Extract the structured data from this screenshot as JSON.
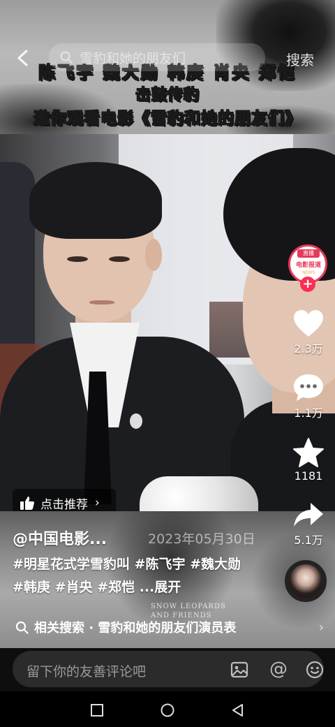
{
  "search": {
    "query": "雪豹和她的朋友们",
    "button": "搜索"
  },
  "banner": {
    "line1": "陈飞宇  魏大勋  韩庚  肖央  郑恺",
    "line2": "击鼓传豹",
    "line3": "邀你观看电影《雪豹和她的朋友们》"
  },
  "recommend": {
    "label": "点击推荐",
    "arrow": "›"
  },
  "post": {
    "author": "@中国电影...",
    "date": "2023年05月30日",
    "hashtags": "#明星花式学雪豹叫 #陈飞宇 #魏大勋 #韩庚 #肖央 #郑恺",
    "expand": "...展开",
    "logo_en_line1": "SNOW LEOPARDS",
    "logo_en_line2": "AND FRIENDS"
  },
  "related": {
    "text": "相关搜索 · 雪豹和她的朋友们演员表",
    "chevron": "›"
  },
  "creator": {
    "tag": "直播",
    "logo": "电影报道",
    "sub": "NEWS",
    "follow": "+"
  },
  "actions": {
    "like": {
      "icon": "heart-icon",
      "count": "2.3万"
    },
    "comment": {
      "icon": "comment-icon",
      "count": "1.1万"
    },
    "favorite": {
      "icon": "star-icon",
      "count": "1181"
    },
    "share": {
      "icon": "share-icon",
      "count": "5.1万"
    }
  },
  "comment_bar": {
    "placeholder": "留下你的友善评论吧",
    "at": "@"
  },
  "colors": {
    "accent": "#fe2c55",
    "banner_text": "#f6d23a"
  }
}
